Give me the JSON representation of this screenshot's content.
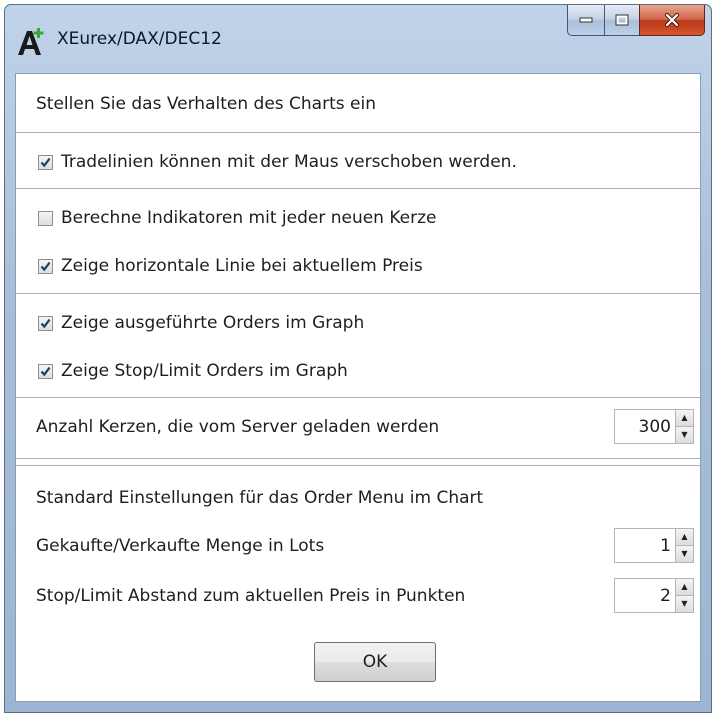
{
  "window": {
    "title": "XEurex/DAX/DEC12",
    "controls": {
      "minimize_icon": "minimize-icon",
      "maximize_icon": "maximize-icon",
      "close_icon": "close-icon"
    }
  },
  "settings": {
    "heading": "Stellen Sie das Verhalten des Charts ein",
    "options": [
      {
        "label": "Tradelinien können mit der Maus verschoben werden.",
        "checked": true
      },
      {
        "label": "Berechne Indikatoren mit jeder neuen Kerze",
        "checked": false
      },
      {
        "label": "Zeige horizontale Linie bei aktuellem Preis",
        "checked": true
      },
      {
        "label": "Zeige ausgeführte Orders im Graph",
        "checked": true
      },
      {
        "label": "Zeige Stop/Limit Orders im Graph",
        "checked": true
      }
    ],
    "candles_label": "Anzahl Kerzen, die vom Server geladen werden",
    "candles_value": "300"
  },
  "order_menu": {
    "heading": "Standard Einstellungen für das Order Menu im Chart",
    "quantity_label": "Gekaufte/Verkaufte Menge in Lots",
    "quantity_value": "1",
    "distance_label": "Stop/Limit Abstand zum aktuellen Preis in Punkten",
    "distance_value": "2"
  },
  "ok_label": "OK",
  "colors": {
    "titlebar": "#a9bfd9",
    "close_button": "#c8472a",
    "check_mark": "#1f3f7a"
  }
}
